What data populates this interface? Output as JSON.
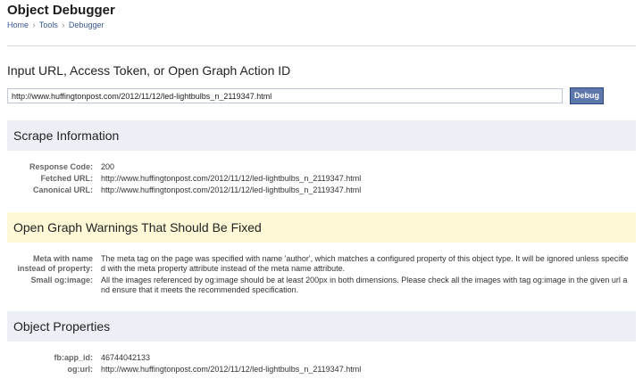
{
  "header": {
    "title": "Object Debugger",
    "breadcrumb": [
      "Home",
      "Tools",
      "Debugger"
    ],
    "breadcrumb_sep": "›"
  },
  "input": {
    "heading": "Input URL, Access Token, or Open Graph Action ID",
    "value": "http://www.huffingtonpost.com/2012/11/12/led-lightbulbs_n_2119347.html",
    "button_label": "Debug"
  },
  "scrape": {
    "title": "Scrape Information",
    "rows": [
      {
        "label": "Response Code:",
        "value": "200"
      },
      {
        "label": "Fetched URL:",
        "value": "http://www.huffingtonpost.com/2012/11/12/led-lightbulbs_n_2119347.html"
      },
      {
        "label": "Canonical URL:",
        "value": "http://www.huffingtonpost.com/2012/11/12/led-lightbulbs_n_2119347.html"
      }
    ]
  },
  "warnings": {
    "title": "Open Graph Warnings That Should Be Fixed",
    "rows": [
      {
        "label_line1": "Meta with name",
        "label_line2": "instead of property:",
        "text_line1": "The meta tag on the page was specified with name 'author', which matches a configured property of this object type. It will be ignored unless specifie",
        "text_line2": "d with the meta property attribute instead of the meta name attribute."
      },
      {
        "label_line1": "Small og:image:",
        "text_line1": "All the images referenced by og:image should be at least 200px in both dimensions. Please check all the images with tag og:image in the given url a",
        "text_line2": "nd ensure that it meets the recommended specification."
      }
    ]
  },
  "properties": {
    "title": "Object Properties",
    "rows": [
      {
        "label": "fb:app_id:",
        "value": "46744042133"
      },
      {
        "label": "og:url:",
        "value": "http://www.huffingtonpost.com/2012/11/12/led-lightbulbs_n_2119347.html"
      }
    ]
  },
  "colors": {
    "link": "#3b5998",
    "button_bg": "#5f78ab",
    "section_gray": "#eceff5",
    "section_yellow": "#fff9d7"
  }
}
